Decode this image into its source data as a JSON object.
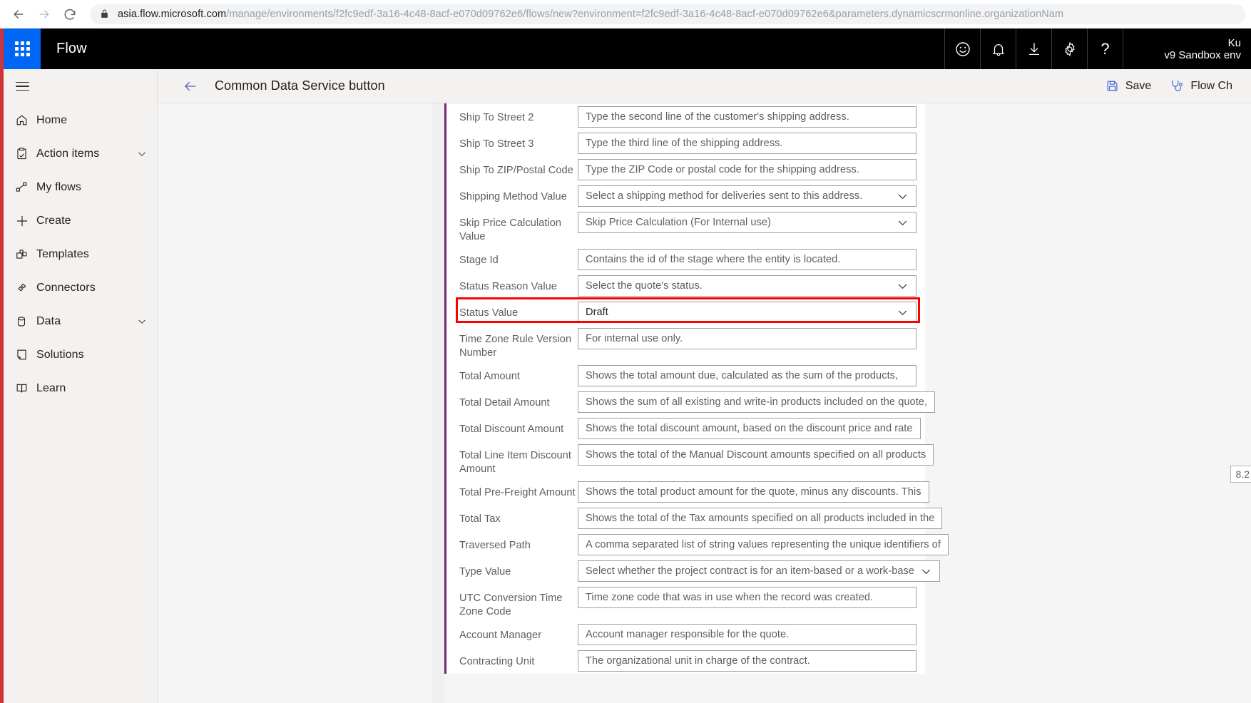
{
  "browser": {
    "url_host": "asia.flow.microsoft.com",
    "url_path": "/manage/environments/f2fc9edf-3a16-4c48-8acf-e070d09762e6/flows/new?environment=f2fc9edf-3a16-4c48-8acf-e070d09762e6&parameters.dynamicscrmonline.organizationNam",
    "back_icon": "back-arrow-icon",
    "forward_icon": "forward-arrow-icon",
    "reload_icon": "reload-icon",
    "lock_icon": "lock-icon"
  },
  "suite": {
    "waffle_label": "app-launcher",
    "brand": "Flow",
    "icons": [
      {
        "name": "feedback-smiley-icon",
        "glyph": "smiley"
      },
      {
        "name": "notifications-bell-icon",
        "glyph": "bell"
      },
      {
        "name": "download-icon",
        "glyph": "download"
      },
      {
        "name": "settings-gear-icon",
        "glyph": "gear"
      },
      {
        "name": "help-question-icon",
        "glyph": "?"
      }
    ],
    "user_name": "Ku",
    "environment": "v9 Sandbox env"
  },
  "sidebar": {
    "items": [
      {
        "label": "Home",
        "icon": "home-icon",
        "chevron": false
      },
      {
        "label": "Action items",
        "icon": "clipboard-check-icon",
        "chevron": true
      },
      {
        "label": "My flows",
        "icon": "flow-nodes-icon",
        "chevron": false
      },
      {
        "label": "Create",
        "icon": "plus-icon",
        "chevron": false
      },
      {
        "label": "Templates",
        "icon": "templates-icon",
        "chevron": false
      },
      {
        "label": "Connectors",
        "icon": "connectors-icon",
        "chevron": false
      },
      {
        "label": "Data",
        "icon": "database-icon",
        "chevron": true
      },
      {
        "label": "Solutions",
        "icon": "solutions-icon",
        "chevron": false
      },
      {
        "label": "Learn",
        "icon": "book-icon",
        "chevron": false
      }
    ]
  },
  "command_bar": {
    "back_icon": "back-arrow-icon",
    "title": "Common Data Service button",
    "save_label": "Save",
    "save_icon": "save-disk-icon",
    "flow_checker_label": "Flow Ch",
    "flow_checker_icon": "stethoscope-icon"
  },
  "form": {
    "partial_top_row": {
      "label": "",
      "placeholder": ""
    },
    "rows": [
      {
        "label": "Ship To Street 2",
        "placeholder": "Type the second line of the customer's shipping address.",
        "type": "text",
        "value": "",
        "highlighted": false
      },
      {
        "label": "Ship To Street 3",
        "placeholder": "Type the third line of the shipping address.",
        "type": "text",
        "value": "",
        "highlighted": false
      },
      {
        "label": "Ship To ZIP/Postal Code",
        "placeholder": "Type the ZIP Code or postal code for the shipping address.",
        "type": "text",
        "value": "",
        "highlighted": false
      },
      {
        "label": "Shipping Method Value",
        "placeholder": "Select a shipping method for deliveries sent to this address.",
        "type": "dropdown",
        "value": "",
        "highlighted": false
      },
      {
        "label": "Skip Price Calculation Value",
        "placeholder": "Skip Price Calculation (For Internal use)",
        "type": "dropdown",
        "value": "",
        "highlighted": false
      },
      {
        "label": "Stage Id",
        "placeholder": "Contains the id of the stage where the entity is located.",
        "type": "text",
        "value": "",
        "highlighted": false
      },
      {
        "label": "Status Reason Value",
        "placeholder": "Select the quote's status.",
        "type": "dropdown",
        "value": "",
        "highlighted": false
      },
      {
        "label": "Status Value",
        "placeholder": "",
        "type": "dropdown",
        "value": "Draft",
        "highlighted": true
      },
      {
        "label": "Time Zone Rule Version Number",
        "placeholder": "For internal use only.",
        "type": "text",
        "value": "",
        "highlighted": false
      },
      {
        "label": "Total Amount",
        "placeholder": "Shows the total amount due, calculated as the sum of the products,",
        "type": "text",
        "value": "",
        "highlighted": false
      },
      {
        "label": "Total Detail Amount",
        "placeholder": "Shows the sum of all existing and write-in products included on the quote,",
        "type": "text",
        "value": "",
        "highlighted": false
      },
      {
        "label": "Total Discount Amount",
        "placeholder": "Shows the total discount amount, based on the discount price and rate",
        "type": "text",
        "value": "",
        "highlighted": false
      },
      {
        "label": "Total Line Item Discount Amount",
        "placeholder": "Shows the total of the Manual Discount amounts specified on all products",
        "type": "text",
        "value": "",
        "highlighted": false
      },
      {
        "label": "Total Pre-Freight Amount",
        "placeholder": "Shows the total product amount for the quote, minus any discounts. This",
        "type": "text",
        "value": "",
        "highlighted": false
      },
      {
        "label": "Total Tax",
        "placeholder": "Shows the total of the Tax amounts specified on all products included in the",
        "type": "text",
        "value": "",
        "highlighted": false
      },
      {
        "label": "Traversed Path",
        "placeholder": "A comma separated list of string values representing the unique identifiers of",
        "type": "text",
        "value": "",
        "highlighted": false
      },
      {
        "label": "Type Value",
        "placeholder": "Select whether the project contract is for an item-based or a work-base",
        "type": "dropdown",
        "value": "",
        "highlighted": false
      },
      {
        "label": "UTC Conversion Time Zone Code",
        "placeholder": "Time zone code that was in use when the record was created.",
        "type": "text",
        "value": "",
        "highlighted": false
      },
      {
        "label": "Account Manager",
        "placeholder": "Account manager responsible for the quote.",
        "type": "text",
        "value": "",
        "highlighted": false
      },
      {
        "label": "Contracting Unit",
        "placeholder": "The organizational unit in charge of the contract.",
        "type": "text",
        "value": "",
        "highlighted": false
      }
    ]
  },
  "zoom_chip": {
    "value": "8.2"
  },
  "colors": {
    "accent_blue": "#0067f4",
    "suite_black": "#000000",
    "card_accent": "#742774",
    "highlight_red": "#fe0000",
    "left_strip_red": "#d13438"
  }
}
